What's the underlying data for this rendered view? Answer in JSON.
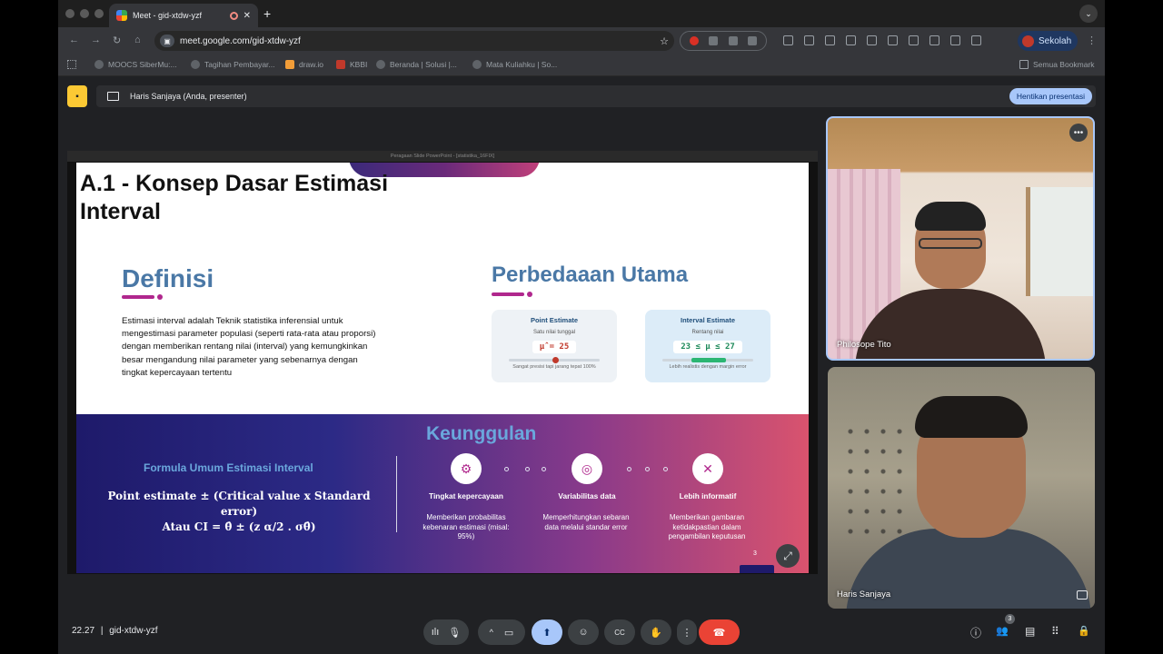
{
  "browser": {
    "tab_title": "Meet - gid-xtdw-yzf",
    "close_glyph": "✕",
    "new_tab_glyph": "+",
    "tab_menu_glyph": "⌄",
    "nav_back": "←",
    "nav_forward": "→",
    "nav_reload": "↻",
    "nav_home": "⌂",
    "url": "meet.google.com/gid-xtdw-yzf",
    "star_glyph": "☆",
    "profile_label": "Sekolah",
    "kebab_glyph": "⋮",
    "bookmarks": [
      "MOOCS SiberMu:...",
      "Tagihan Pembayar...",
      "draw.io",
      "KBBI",
      "Beranda | Solusi |...",
      "Mata Kuliahku | So..."
    ],
    "all_bookmarks": "Semua Bookmark"
  },
  "meet": {
    "presenter_label": "Haris Sanjaya (Anda, presenter)",
    "stop_presenting": "Hentikan presentasi",
    "clock": "22.27",
    "separator": "|",
    "meeting_code": "gid-xtdw-yzf",
    "participants_count": "3",
    "expand_glyph": "⤢",
    "more_glyph": "•••",
    "control_glyphs": {
      "mic_bars": "ılı",
      "mic": "🎙",
      "caret": "^",
      "camera": "▭",
      "present": "⬆",
      "emoji": "☺",
      "captions": "CC",
      "hand": "✋",
      "more": "⋮",
      "end": "☎"
    },
    "right_glyphs": {
      "info": "ⓘ",
      "people": "👥",
      "chat": "▤",
      "activities": "⠿",
      "host": "🔒"
    }
  },
  "slide": {
    "window_title": "Peragaan Slide PowerPoint - [statistika_16FIX]",
    "title": "A.1 - Konsep Dasar Estimasi Interval",
    "definition_heading": "Definisi",
    "definition_text": "Estimasi interval adalah Teknik statistika inferensial untuk mengestimasi parameter populasi (seperti rata-rata atau proporsi) dengan memberikan rentang nilai (interval) yang kemungkinkan besar mengandung nilai parameter yang sebenarnya dengan tingkat kepercayaan tertentu",
    "difference_heading": "Perbedaaan Utama",
    "cards": [
      {
        "title": "Point Estimate",
        "subtitle": "Satu nilai tunggal",
        "value": "μ̂ = 25",
        "note": "Sangat presisi tapi jarang tepat 100%"
      },
      {
        "title": "Interval Estimate",
        "subtitle": "Rentang nilai",
        "value": "23 ≤ μ ≤ 27",
        "note": "Lebih realistis dengan margin error"
      }
    ],
    "formula_heading": "Formula Umum Estimasi Interval",
    "formula_line1": "Point estimate ± (Critical value x Standard error)",
    "formula_line2": "Atau CI = θ̂ ± (z α/2 . σθ̂)",
    "advantages_heading": "Keunggulan",
    "advantages": [
      {
        "icon": "⚙",
        "label": "Tingkat kepercayaan",
        "desc": "Memberikan probabilitas kebenaran estimasi (misal: 95%)"
      },
      {
        "icon": "◎",
        "label": "Variabilitas data",
        "desc": "Memperhitungkan sebaran data melalui standar error"
      },
      {
        "icon": "✕",
        "label": "Lebih informatif",
        "desc": "Memberikan gambaran ketidakpastian dalam pengambilan keputusan"
      }
    ],
    "page_number": "3"
  },
  "participants": [
    {
      "name": "Philosope Tito"
    },
    {
      "name": "Haris Sanjaya"
    }
  ],
  "colors": {
    "accent_blue": "#a8c7fa",
    "end_call": "#ea4335",
    "slide_heading": "#4a78a6",
    "slide_accent": "#b0278d"
  }
}
